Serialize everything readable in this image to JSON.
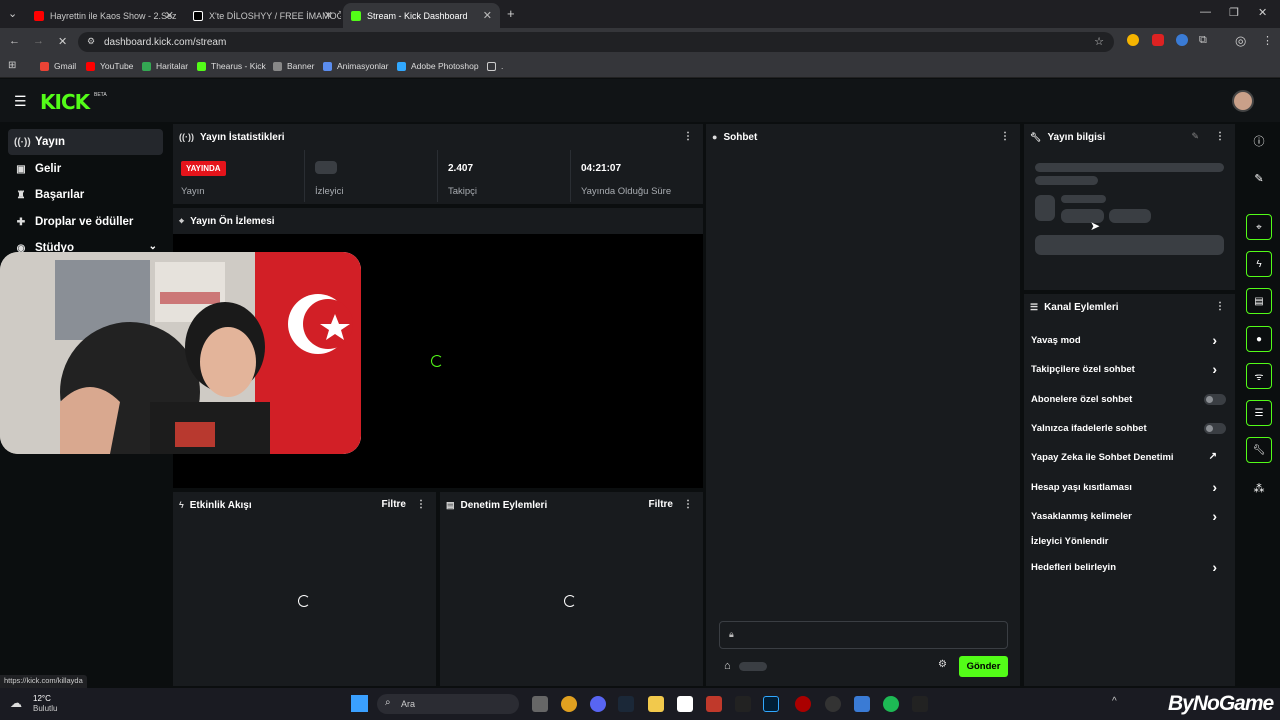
{
  "browser": {
    "tabs": [
      {
        "title": "Hayrettin ile Kaos Show - 2.Sez",
        "favicon_color": "#ff0000"
      },
      {
        "title": "X'te DİLOSHYY / FREE İMAMOĞ",
        "favicon_color": "#ffffff"
      },
      {
        "title": "Stream - Kick Dashboard",
        "favicon_color": "#53fc18"
      }
    ],
    "url": "dashboard.kick.com/stream",
    "bookmarks": [
      {
        "label": "Gmail",
        "color": "#ea4335"
      },
      {
        "label": "YouTube",
        "color": "#ff0000"
      },
      {
        "label": "Haritalar",
        "color": "#34a853"
      },
      {
        "label": "Thearus - Kick",
        "color": "#53fc18"
      },
      {
        "label": "Banner",
        "color": "#888888"
      },
      {
        "label": "Animasyonlar",
        "color": "#5b8def"
      },
      {
        "label": "Adobe Photoshop",
        "color": "#31a8ff"
      },
      {
        "label": ".",
        "color": "#cccccc"
      }
    ]
  },
  "app": {
    "logo": "KICK",
    "beta": "BETA",
    "accent": "#53fc18"
  },
  "sidebar": {
    "items": [
      {
        "label": "Yayın",
        "icon": "broadcast-icon"
      },
      {
        "label": "Gelir",
        "icon": "wallet-icon"
      },
      {
        "label": "Başarılar",
        "icon": "trophy-icon"
      },
      {
        "label": "Droplar ve ödüller",
        "icon": "gift-icon"
      },
      {
        "label": "Stüdyo",
        "icon": "studio-icon"
      }
    ]
  },
  "stats": {
    "title": "Yayın İstatistikleri",
    "live_badge": "YAYINDA",
    "columns": [
      {
        "value": "",
        "label": "Yayın"
      },
      {
        "value": "",
        "label": "İzleyici"
      },
      {
        "value": "2.407",
        "label": "Takipçi"
      },
      {
        "value": "04:21:07",
        "label": "Yayında Olduğu Süre"
      }
    ]
  },
  "preview": {
    "title": "Yayın Ön İzlemesi"
  },
  "activity": {
    "title": "Etkinlik Akışı",
    "filter": "Filtre"
  },
  "moderation": {
    "title": "Denetim Eylemleri",
    "filter": "Filtre"
  },
  "chat": {
    "title": "Sohbet",
    "send": "Gönder"
  },
  "stream_info": {
    "title": "Yayın bilgisi"
  },
  "channel_actions": {
    "title": "Kanal Eylemleri",
    "items": [
      {
        "label": "Yavaş mod",
        "control": "chevron"
      },
      {
        "label": "Takipçilere özel sohbet",
        "control": "chevron"
      },
      {
        "label": "Abonelere özel sohbet",
        "control": "toggle"
      },
      {
        "label": "Yalnızca ifadelerle sohbet",
        "control": "toggle"
      },
      {
        "label": "Yapay Zeka ile Sohbet Denetimi",
        "control": "external"
      },
      {
        "label": "Hesap yaşı kısıtlaması",
        "control": "chevron"
      },
      {
        "label": "Yasaklanmış kelimeler",
        "control": "chevron"
      },
      {
        "label": "İzleyici Yönlendir",
        "control": "none"
      },
      {
        "label": "Hedefleri belirleyin",
        "control": "chevron"
      }
    ]
  },
  "status_url": "https://kick.com/killayda",
  "taskbar": {
    "weather_temp": "12°C",
    "weather_desc": "Bulutlu",
    "search_placeholder": "Ara",
    "watermark": "ByNoGame"
  }
}
